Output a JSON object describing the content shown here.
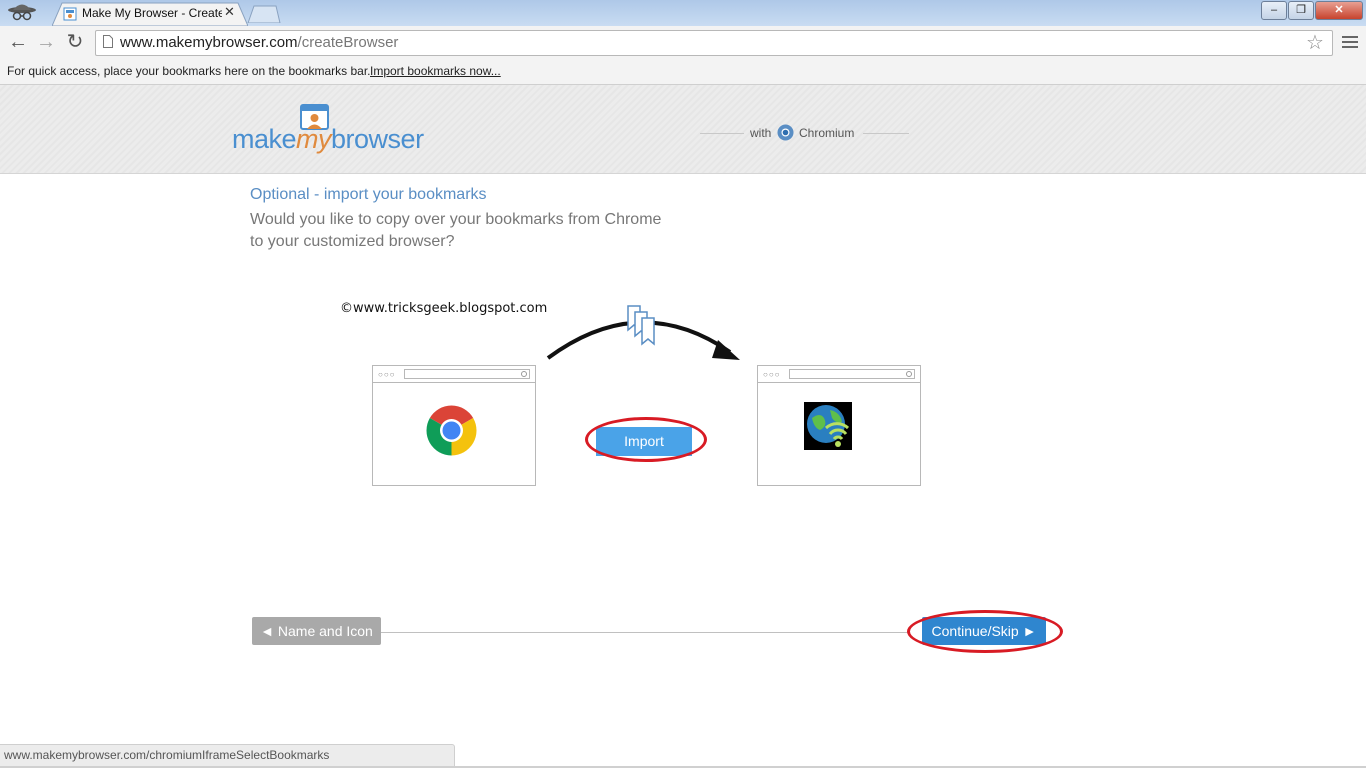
{
  "tab": {
    "title": "Make My Browser - Create",
    "close": "✕"
  },
  "window": {
    "minimize": "–",
    "maximize": "❐",
    "close": "✕"
  },
  "toolbar": {
    "back": "←",
    "forward": "→",
    "reload": "↻",
    "url_domain": "www.makemybrowser.com",
    "url_path": "/createBrowser",
    "star": "☆"
  },
  "bookmarks_bar": {
    "message": "For quick access, place your bookmarks here on the bookmarks bar.",
    "import_link": "Import bookmarks now..."
  },
  "header": {
    "logo_pre": "make",
    "logo_my": "my",
    "logo_post": "browser",
    "with": "with",
    "engine": "Chromium"
  },
  "content": {
    "title": "Optional - import your bookmarks",
    "question_line1": "Would you like to copy over your bookmarks from Chrome",
    "question_line2": "to your customized browser?",
    "watermark": "©www.tricksgeek.blogspot.com",
    "import_label": "Import"
  },
  "nav": {
    "prev_label": "◄ Name and Icon",
    "continue_label": "Continue/Skip ►"
  },
  "status": {
    "url": "www.makemybrowser.com/chromiumIframeSelectBookmarks"
  },
  "colors": {
    "accent": "#4aa3e8",
    "highlight": "#d81b24",
    "title_blue": "#5a8ec4"
  }
}
